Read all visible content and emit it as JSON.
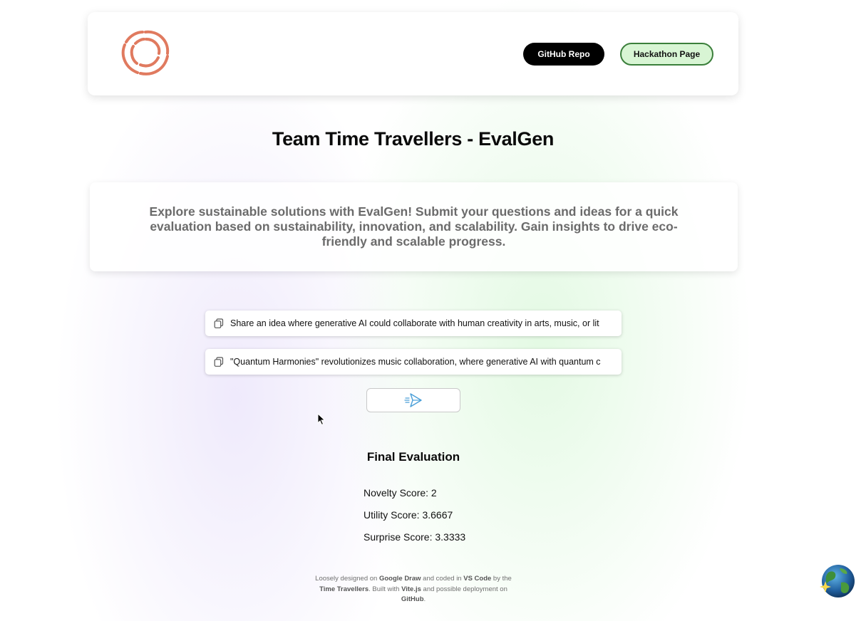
{
  "header": {
    "logo_icon": "spiral-logo-icon",
    "github_label": "GitHub Repo",
    "hackathon_label": "Hackathon Page"
  },
  "page_title": "Team Time Travellers - EvalGen",
  "description": "Explore sustainable solutions with EvalGen! Submit your questions and ideas for a quick evaluation based on sustainability, innovation, and scalability. Gain insights to drive eco-friendly and scalable progress.",
  "inputs": {
    "question_value": "Share an idea where generative AI could collaborate with human creativity in arts, music, or lit",
    "idea_value": "\"Quantum Harmonies\" revolutionizes music collaboration, where generative AI with quantum c",
    "copy_icon": "copy-icon"
  },
  "send_button_icon": "send-icon",
  "evaluation": {
    "title": "Final Evaluation",
    "novelty": "Novelty Score: 2",
    "utility": "Utility Score: 3.6667",
    "surprise": "Surprise Score: 3.3333"
  },
  "footer": {
    "t1": "Loosely designed on ",
    "google_draw": "Google Draw",
    "t2": " and coded in ",
    "vscode": "VS Code",
    "t3": " by the ",
    "team": "Time Travellers",
    "t4": ". Built with ",
    "vite": "Vite.js",
    "t5": " and possible deployment on ",
    "github": "GitHub",
    "t6": "."
  },
  "colors": {
    "accent_logo": "#e07a5f",
    "hackathon_bg": "#d8f5d4",
    "hackathon_border": "#3b7f3b",
    "send_icon": "#4a9fd8"
  }
}
